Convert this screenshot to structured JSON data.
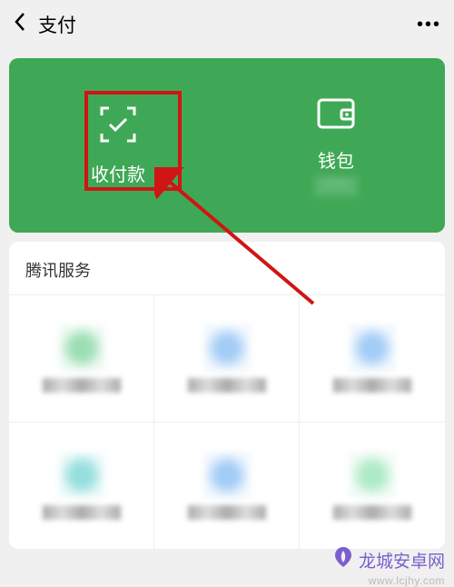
{
  "header": {
    "title": "支付"
  },
  "greenCard": {
    "payReceive": {
      "label": "收付款"
    },
    "wallet": {
      "label": "钱包",
      "balance": "****"
    }
  },
  "services": {
    "title": "腾讯服务"
  },
  "watermark": {
    "text": "龙城安卓网",
    "sub": "www.lcjhy.com"
  }
}
